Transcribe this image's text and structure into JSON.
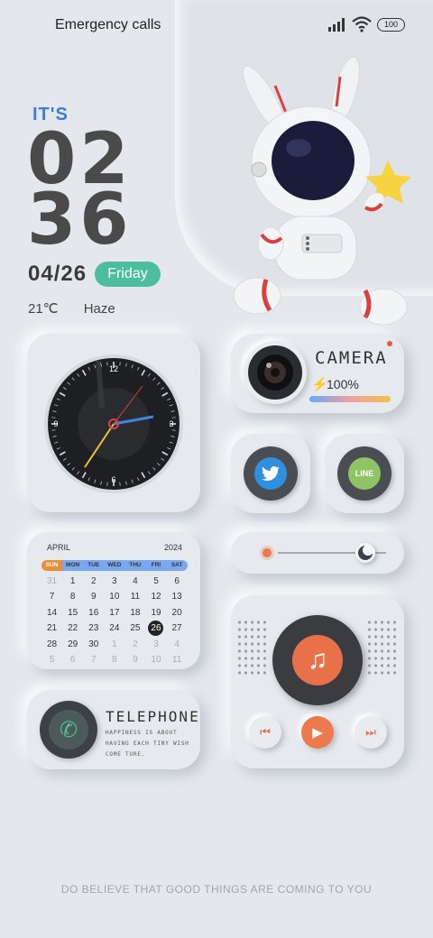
{
  "status_bar": {
    "carrier": "Emergency calls o",
    "battery": "100"
  },
  "lock": {
    "its": "IT'S",
    "hour": "02",
    "minute": "36",
    "date": "04/26",
    "day": "Friday",
    "temperature": "21℃",
    "condition": "Haze"
  },
  "camera_widget": {
    "title": "CAMERA",
    "percent": "100%",
    "level": 1.0
  },
  "social": {
    "twitter_icon": "twitter-bird-icon",
    "line_label": "LINE"
  },
  "calendar": {
    "month": "APRIL",
    "year": "2024",
    "weekdays": [
      "SUN",
      "MON",
      "TUE",
      "WED",
      "THU",
      "FRI",
      "SAT"
    ],
    "weeks": [
      [
        "31",
        "1",
        "2",
        "3",
        "4",
        "5",
        "6"
      ],
      [
        "7",
        "8",
        "9",
        "10",
        "11",
        "12",
        "13"
      ],
      [
        "14",
        "15",
        "16",
        "17",
        "18",
        "19",
        "20"
      ],
      [
        "21",
        "22",
        "23",
        "24",
        "25",
        "26",
        "27"
      ],
      [
        "28",
        "29",
        "30",
        "1",
        "2",
        "3",
        "4"
      ],
      [
        "5",
        "6",
        "7",
        "8",
        "9",
        "10",
        "11"
      ]
    ],
    "today": "26"
  },
  "telephone": {
    "title": "TELEPHONE",
    "subtitle": "HAPPINESS IS ABOUT HAVING EACH TINY WISH COME TURE."
  },
  "music": {
    "prev_icon": "previous-icon",
    "play_icon": "play-icon",
    "next_icon": "next-icon"
  },
  "motto": "DO BELIEVE THAT GOOD THINGS ARE COMING TO YOU",
  "clock_numbers": [
    "12",
    "3",
    "6",
    "9"
  ]
}
